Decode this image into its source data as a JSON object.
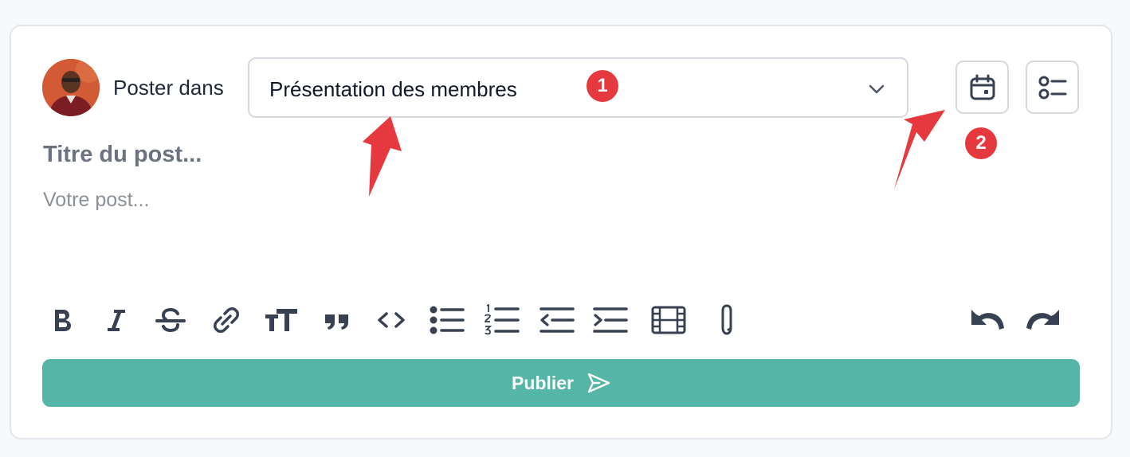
{
  "composer": {
    "post_in_label": "Poster dans",
    "space_select": {
      "selected": "Présentation des membres"
    },
    "title_placeholder": "Titre du post...",
    "body_placeholder": "Votre post..."
  },
  "toolbar": {
    "items": [
      {
        "name": "bold-icon"
      },
      {
        "name": "italic-icon"
      },
      {
        "name": "strikethrough-icon"
      },
      {
        "name": "link-icon"
      },
      {
        "name": "text-size-icon"
      },
      {
        "name": "quote-icon"
      },
      {
        "name": "code-icon"
      },
      {
        "name": "bullet-list-icon"
      },
      {
        "name": "numbered-list-icon"
      },
      {
        "name": "outdent-icon"
      },
      {
        "name": "indent-icon"
      },
      {
        "name": "video-icon"
      },
      {
        "name": "attachment-icon"
      },
      {
        "name": "undo-icon"
      },
      {
        "name": "redo-icon"
      }
    ]
  },
  "publish": {
    "label": "Publier"
  },
  "annotations": {
    "badge_1": "1",
    "badge_2": "2"
  },
  "colors": {
    "accent": "#55b5a6",
    "annotation": "#e5393f",
    "icon": "#374151"
  }
}
